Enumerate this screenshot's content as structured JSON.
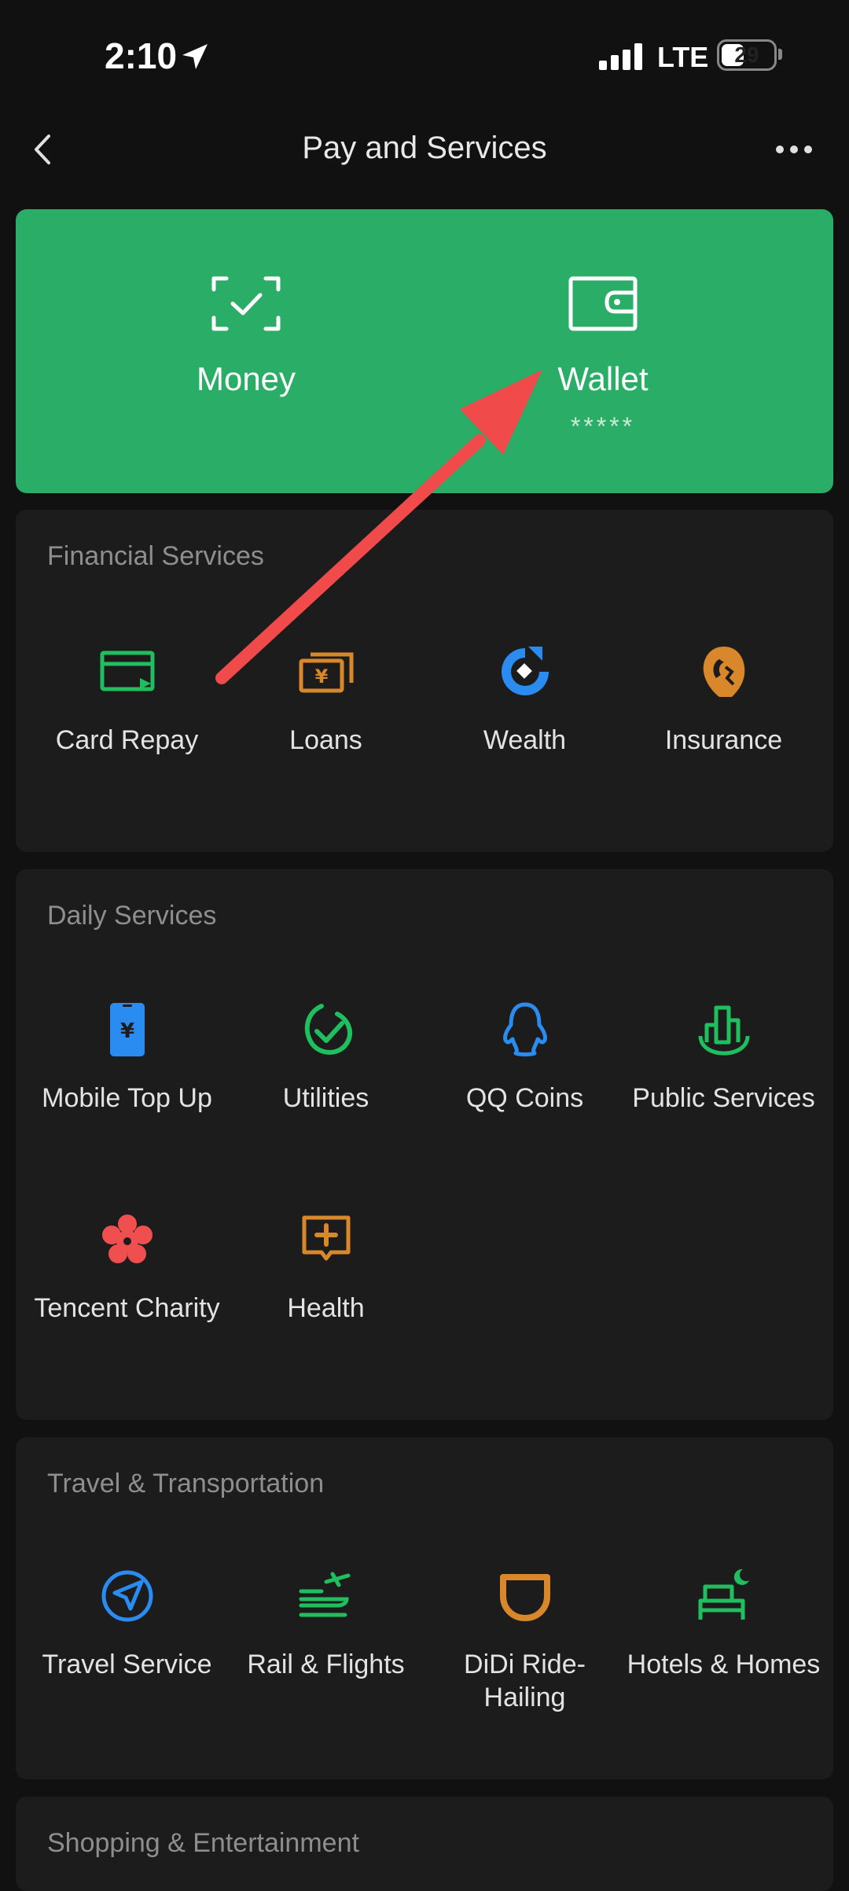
{
  "status_bar": {
    "time": "2:10",
    "network": "LTE",
    "battery": "29"
  },
  "nav": {
    "title": "Pay and Services"
  },
  "hero": {
    "money_label": "Money",
    "wallet_label": "Wallet",
    "wallet_masked": "*****"
  },
  "sections": {
    "financial": {
      "title": "Financial Services",
      "items": [
        "Card Repay",
        "Loans",
        "Wealth",
        "Insurance"
      ]
    },
    "daily": {
      "title": "Daily Services",
      "items": [
        "Mobile Top Up",
        "Utilities",
        "QQ Coins",
        "Public Services",
        "Tencent Charity",
        "Health"
      ]
    },
    "travel": {
      "title": "Travel & Transportation",
      "items": [
        "Travel Service",
        "Rail & Flights",
        "DiDi Ride-Hailing",
        "Hotels & Homes"
      ]
    },
    "shopping": {
      "title": "Shopping & Entertainment"
    }
  },
  "colors": {
    "accent_green": "#2aae67",
    "icon_green": "#1fbf5f",
    "icon_orange": "#d8872a",
    "icon_blue": "#2a8cf0",
    "icon_red": "#f04f4f",
    "annotation_arrow": "#f04a4a"
  },
  "icons": {
    "money": "scan-check-icon",
    "wallet": "wallet-icon",
    "card_repay": "credit-card-icon",
    "loans": "yuan-bill-icon",
    "wealth": "wealth-swirl-icon",
    "insurance": "umbrella-shield-icon",
    "mobile_top_up": "phone-yuan-icon",
    "utilities": "leaf-check-icon",
    "qq_coins": "penguin-icon",
    "public_services": "city-building-icon",
    "tencent_charity": "flower-icon",
    "health": "medical-cross-icon",
    "travel_service": "compass-icon",
    "rail_flights": "train-plane-icon",
    "didi": "didi-icon",
    "hotels_homes": "bed-icon"
  }
}
